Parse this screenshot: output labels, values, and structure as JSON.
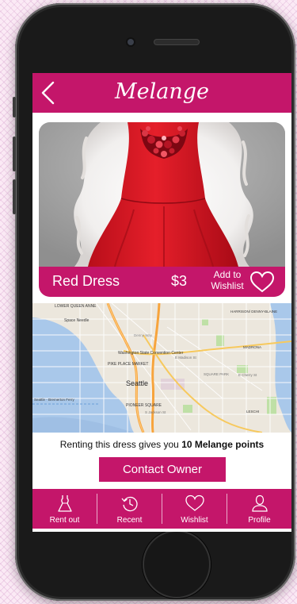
{
  "app": {
    "title": "Melange",
    "back_icon": "chevron-left-icon",
    "brand_color": "#c4166a"
  },
  "item": {
    "name": "Red Dress",
    "price": "$3",
    "wishlist_label": "Add to Wishlist",
    "wishlist_icon": "heart-outline-icon",
    "image": "red-dress-photo"
  },
  "map": {
    "labels": {
      "lower_queen_anne": "LOWER QUEEN ANNE",
      "space_needle": "Space Needle",
      "convention": "Washington State Convention Center",
      "pike_place": "PIKE PLACE MARKET",
      "city": "Seattle",
      "ferry": "Seattle - Bremerton Ferry",
      "pioneer": "PIONEER SQUARE",
      "cherry": "E Cherry St",
      "madrona": "MADRONA",
      "hampton": "HARRISON/ DENNY-BLAINE",
      "denny": "Denny Way",
      "leschi": "LESCHI",
      "madison": "E Madison St",
      "square_park": "SQUARE PARK",
      "jackson": "S Jackson St"
    }
  },
  "promo": {
    "text_before": "Renting this dress gives you ",
    "points": "10 Melange points"
  },
  "contact_label": "Contact Owner",
  "tabs": [
    {
      "label": "Rent out",
      "icon": "dress-icon"
    },
    {
      "label": "Recent",
      "icon": "history-clock-icon"
    },
    {
      "label": "Wishlist",
      "icon": "heart-icon"
    },
    {
      "label": "Profile",
      "icon": "person-icon"
    }
  ]
}
